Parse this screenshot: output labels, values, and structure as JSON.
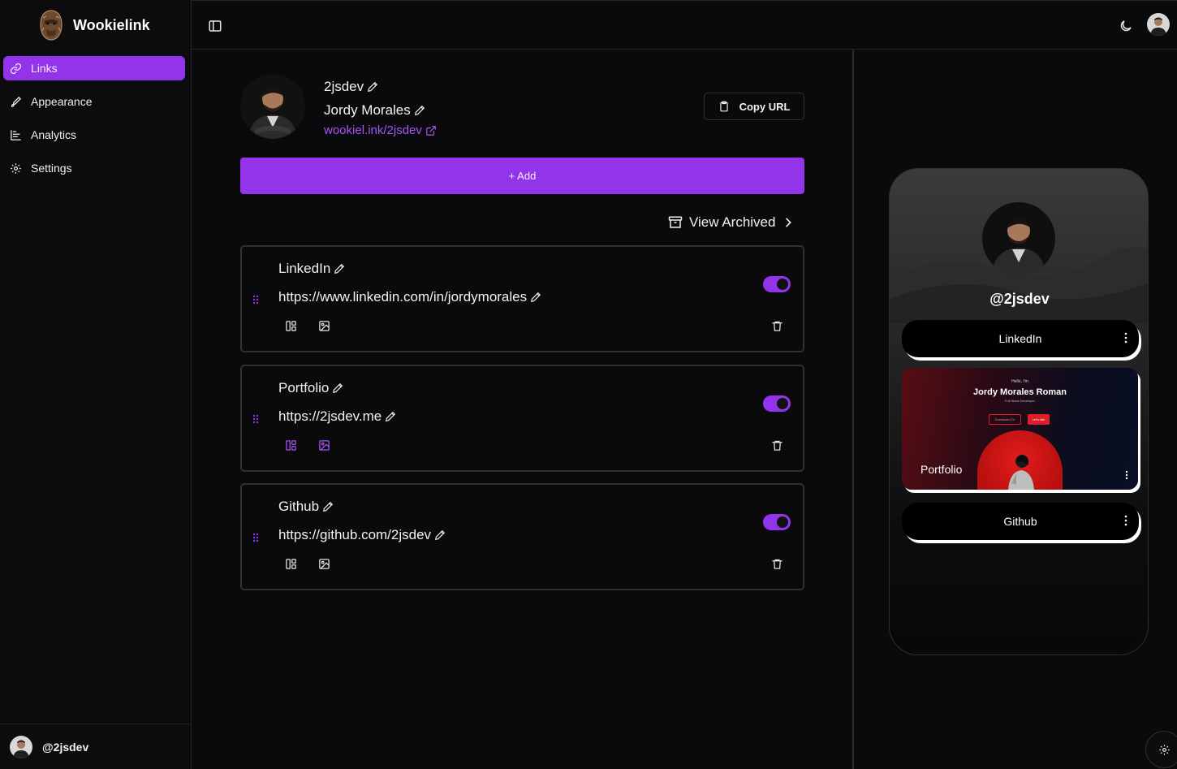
{
  "app": {
    "name": "Wookielink"
  },
  "sidebar": {
    "items": [
      {
        "label": "Links",
        "icon": "link-icon",
        "active": true
      },
      {
        "label": "Appearance",
        "icon": "brush-icon",
        "active": false
      },
      {
        "label": "Analytics",
        "icon": "chart-icon",
        "active": false
      },
      {
        "label": "Settings",
        "icon": "gear-icon",
        "active": false
      }
    ],
    "footer_user": "@2jsdev"
  },
  "profile": {
    "username": "2jsdev",
    "full_name": "Jordy Morales",
    "url": "wookiel.ink/2jsdev",
    "copy_label": "Copy URL"
  },
  "actions": {
    "add_label": "+ Add",
    "archived_label": "View Archived"
  },
  "links": [
    {
      "title": "LinkedIn",
      "url": "https://www.linkedin.com/in/jordymorales",
      "enabled": true,
      "tools_highlighted": false
    },
    {
      "title": "Portfolio",
      "url": "https://2jsdev.me",
      "enabled": true,
      "tools_highlighted": true
    },
    {
      "title": "Github",
      "url": "https://github.com/2jsdev",
      "enabled": true,
      "tools_highlighted": false
    }
  ],
  "preview": {
    "handle": "@2jsdev",
    "links": [
      "LinkedIn",
      "Portfolio",
      "Github"
    ],
    "portfolio_card": {
      "hello": "Hello, I'm",
      "name": "Jordy Morales Roman",
      "role": "Full Stack Developer",
      "button_primary": "Download CV",
      "button_secondary": "Let's talk"
    }
  },
  "colors": {
    "accent": "#9333ea",
    "link": "#a855f7",
    "background": "#0a0a0c"
  }
}
